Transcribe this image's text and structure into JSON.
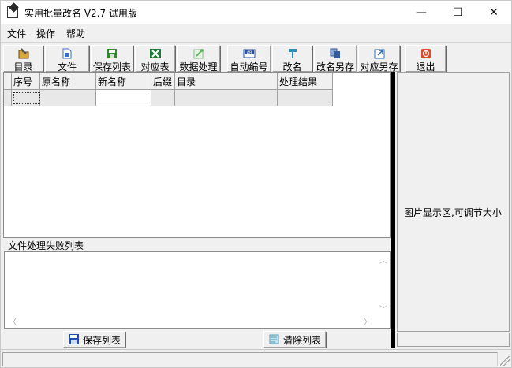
{
  "window": {
    "title": "实用批量改名 V2.7 试用版",
    "minimize_glyph": "—",
    "maximize_glyph": "☐",
    "close_glyph": "✕"
  },
  "menu": [
    "文件",
    "操作",
    "帮助"
  ],
  "toolbar": [
    {
      "label": "目录",
      "icon": "folder-icon",
      "color": "#8b6a2b"
    },
    {
      "label": "文件",
      "icon": "file-icon",
      "color": "#3a6ec8"
    },
    {
      "label": "保存列表",
      "icon": "save-icon",
      "color": "#2d8a2d"
    },
    {
      "label": "对应表",
      "icon": "excel-icon",
      "color": "#1f7a3a"
    },
    {
      "label": "数据处理",
      "icon": "data-icon",
      "color": "#5fb85f"
    },
    {
      "label": "自动编号",
      "icon": "ab-icon",
      "color": "#2b4fa0"
    },
    {
      "label": "改名",
      "icon": "hammer-icon",
      "color": "#2a8fb5"
    },
    {
      "label": "改名另存",
      "icon": "copy-icon",
      "color": "#355a9a"
    },
    {
      "label": "对应另存",
      "icon": "export-icon",
      "color": "#2b6cb0"
    },
    {
      "label": "退出",
      "icon": "exit-icon",
      "color": "#e04a2a"
    }
  ],
  "grid": {
    "columns": [
      "序号",
      "原名称",
      "新名称",
      "后缀",
      "目录",
      "处理结果"
    ]
  },
  "failed_list": {
    "label": "文件处理失败列表"
  },
  "bottom_buttons": {
    "save": "保存列表",
    "clear": "清除列表"
  },
  "picture_area": {
    "text": "图片显示区,可调节大小"
  }
}
